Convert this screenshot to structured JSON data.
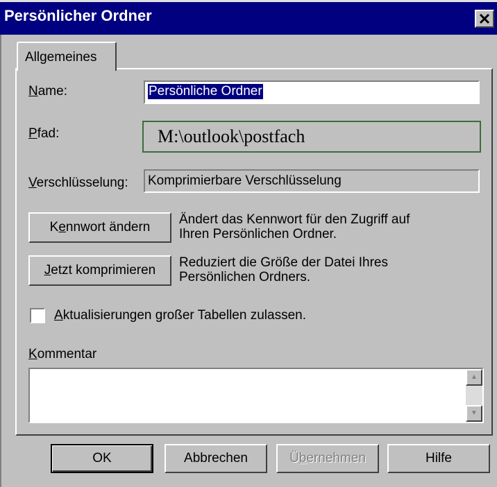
{
  "window": {
    "title": "Persönlicher Ordner",
    "close_icon": "close-icon",
    "close_glyph": "✕"
  },
  "tabs": [
    {
      "label": "Allgemeines",
      "active": true
    }
  ],
  "form": {
    "name_label_key": "N",
    "name_label_rest": "ame:",
    "name_value": "Persönliche Ordner",
    "path_label_key": "P",
    "path_label_rest": "fad:",
    "path_value": "M:\\outlook\\postfach",
    "encryption_label_key": "V",
    "encryption_label_rest": "erschlüsselung:",
    "encryption_value": "Komprimierbare Verschlüsselung"
  },
  "actions": {
    "change_password_pre": "K",
    "change_password_key": "e",
    "change_password_post": "nnwort ändern",
    "change_password_desc_1": "Ändert das Kennwort für den Zugriff auf",
    "change_password_desc_2": "Ihren Persönlichen Ordner.",
    "compress_key": "J",
    "compress_post": "etzt komprimieren",
    "compress_desc_1": "Reduziert die Größe der Datei Ihres",
    "compress_desc_2": "Persönlichen Ordners."
  },
  "checkbox": {
    "key": "A",
    "rest": "ktualisierungen großer Tabellen zulassen.",
    "checked": false
  },
  "comment": {
    "label_key": "K",
    "label_rest": "ommentar",
    "value": "",
    "scroll_up_glyph": "▲",
    "scroll_down_glyph": "▼"
  },
  "buttons": {
    "ok": "OK",
    "cancel": "Abbrechen",
    "apply_pre": "Ü",
    "apply_key": "b",
    "apply_post": "ernehmen",
    "apply_disabled": true,
    "help": "Hilfe"
  },
  "colors": {
    "title_bar": "#000080",
    "dialog_face": "#c0c0c0",
    "selection": "#000080",
    "path_border": "#3d6b3d"
  }
}
